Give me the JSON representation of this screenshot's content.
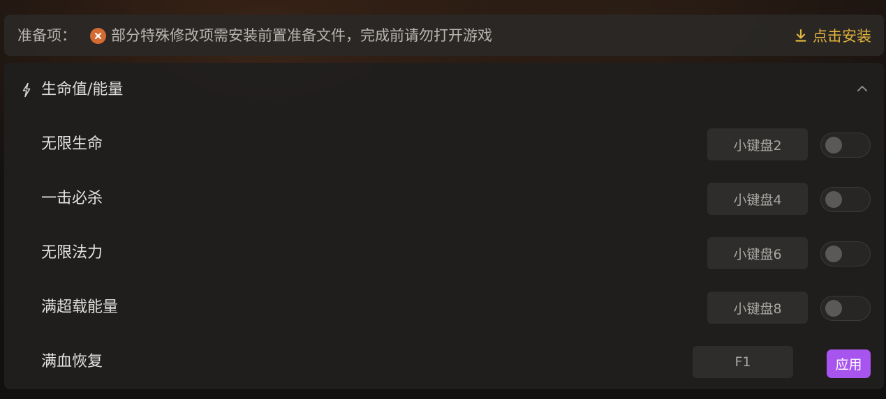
{
  "prereq": {
    "label": "准备项：",
    "message": "部分特殊修改项需安装前置准备文件，完成前请勿打开游戏",
    "install_label": "点击安装",
    "status_icon": "error-x-icon",
    "install_icon": "download-icon"
  },
  "section": {
    "title": "生命值/能量",
    "icon": "lightning-bolt-icon",
    "collapse_icon": "chevron-up-icon"
  },
  "rows": [
    {
      "label": "无限生命",
      "hotkey": "小键盘2",
      "control": "toggle",
      "enabled": false
    },
    {
      "label": "一击必杀",
      "hotkey": "小键盘4",
      "control": "toggle",
      "enabled": false
    },
    {
      "label": "无限法力",
      "hotkey": "小键盘6",
      "control": "toggle",
      "enabled": false
    },
    {
      "label": "满超载能量",
      "hotkey": "小键盘8",
      "control": "toggle",
      "enabled": false
    },
    {
      "label": "满血恢复",
      "hotkey": "F1",
      "control": "button",
      "button_label": "应用"
    }
  ],
  "colors": {
    "accent_install": "#e2b53c",
    "error_icon": "#d36b33",
    "apply_button": "#a855f0"
  }
}
